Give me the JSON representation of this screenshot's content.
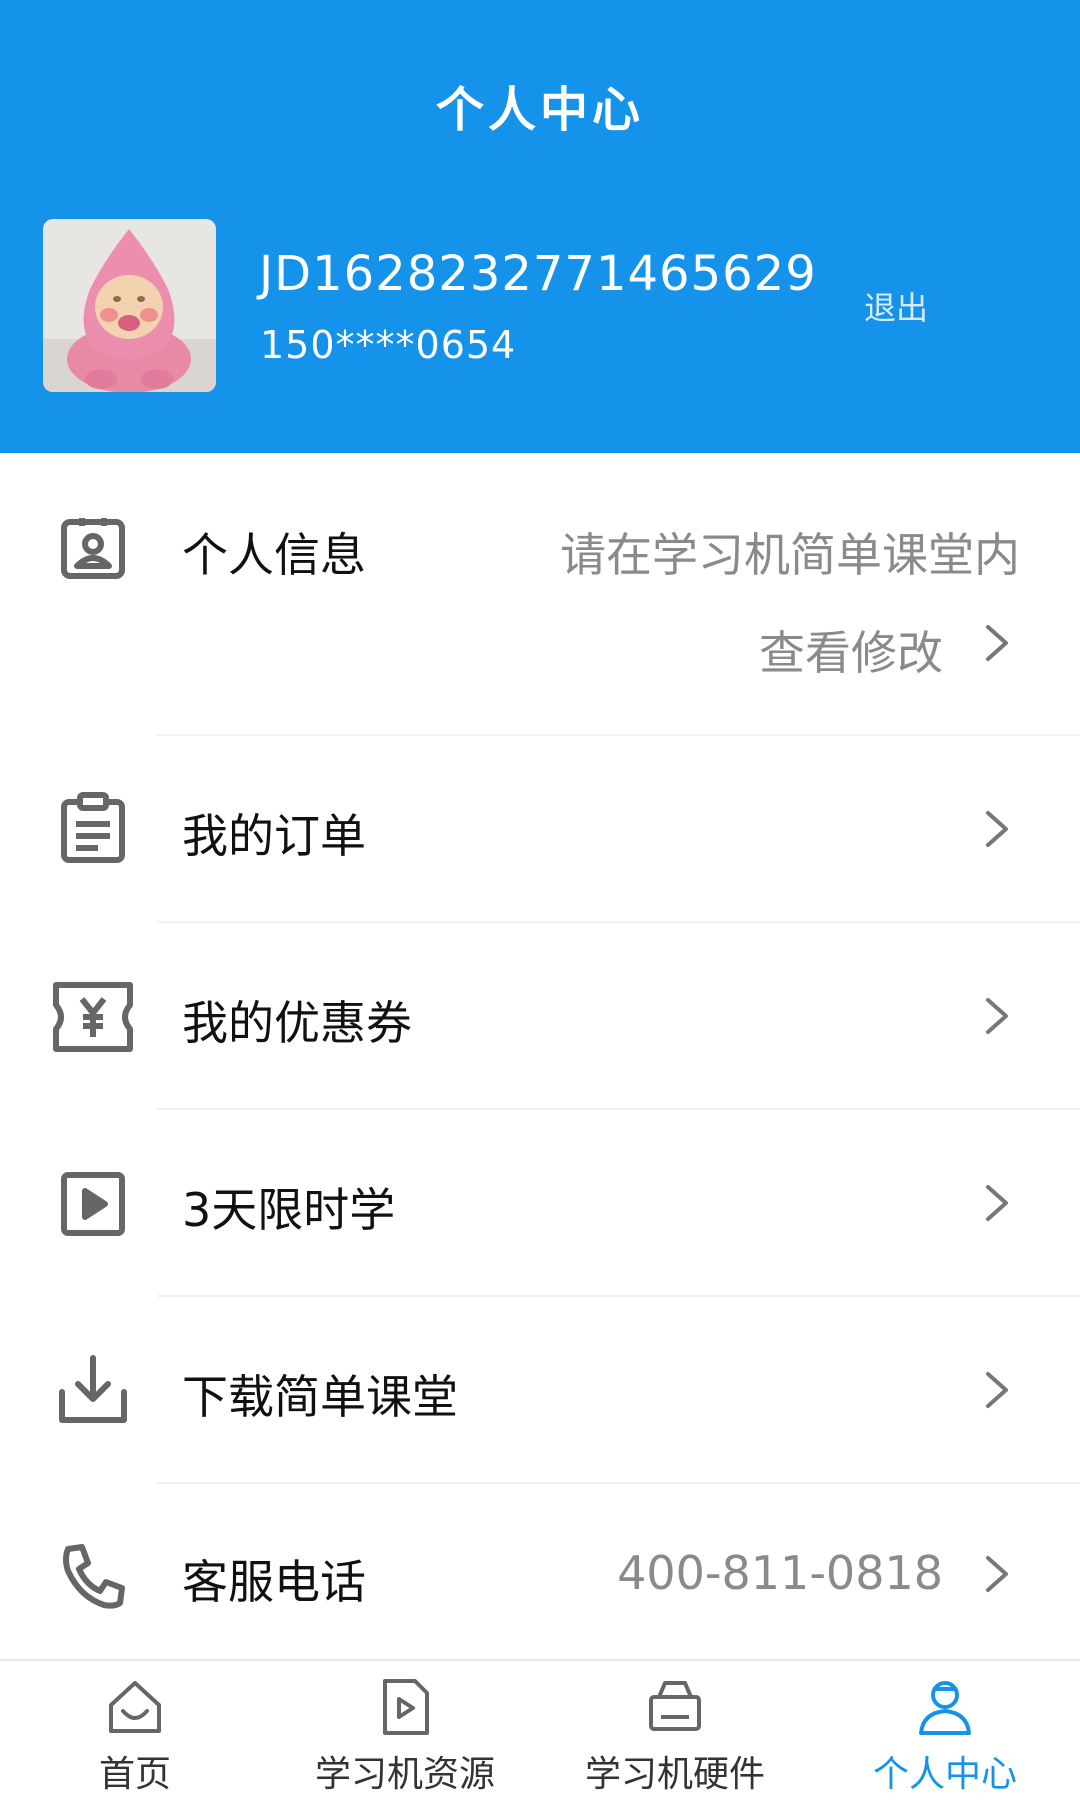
{
  "header": {
    "title": "个人中心",
    "user_id": "JD1628232771465629",
    "phone": "150****0654",
    "logout_label": "退出"
  },
  "menu": {
    "items": [
      {
        "label": "个人信息",
        "value_line1": "请在学习机简单课堂内",
        "value_line2": "查看修改",
        "icon": "contact-card-icon"
      },
      {
        "label": "我的订单",
        "icon": "clipboard-list-icon"
      },
      {
        "label": "我的优惠券",
        "icon": "coupon-yen-icon"
      },
      {
        "label": "3天限时学",
        "icon": "play-box-icon"
      },
      {
        "label": "下载简单课堂",
        "icon": "download-icon"
      },
      {
        "label": "客服电话",
        "value": "400-811-0818",
        "icon": "phone-icon"
      }
    ]
  },
  "tabbar": {
    "items": [
      {
        "label": "首页",
        "icon": "home-icon"
      },
      {
        "label": "学习机资源",
        "icon": "video-file-icon"
      },
      {
        "label": "学习机硬件",
        "icon": "device-icon"
      },
      {
        "label": "个人中心",
        "icon": "person-icon",
        "active": true
      }
    ]
  },
  "colors": {
    "brand_blue": "#1592ea",
    "text_secondary": "#8a8a8a",
    "icon_gray": "#666666"
  }
}
